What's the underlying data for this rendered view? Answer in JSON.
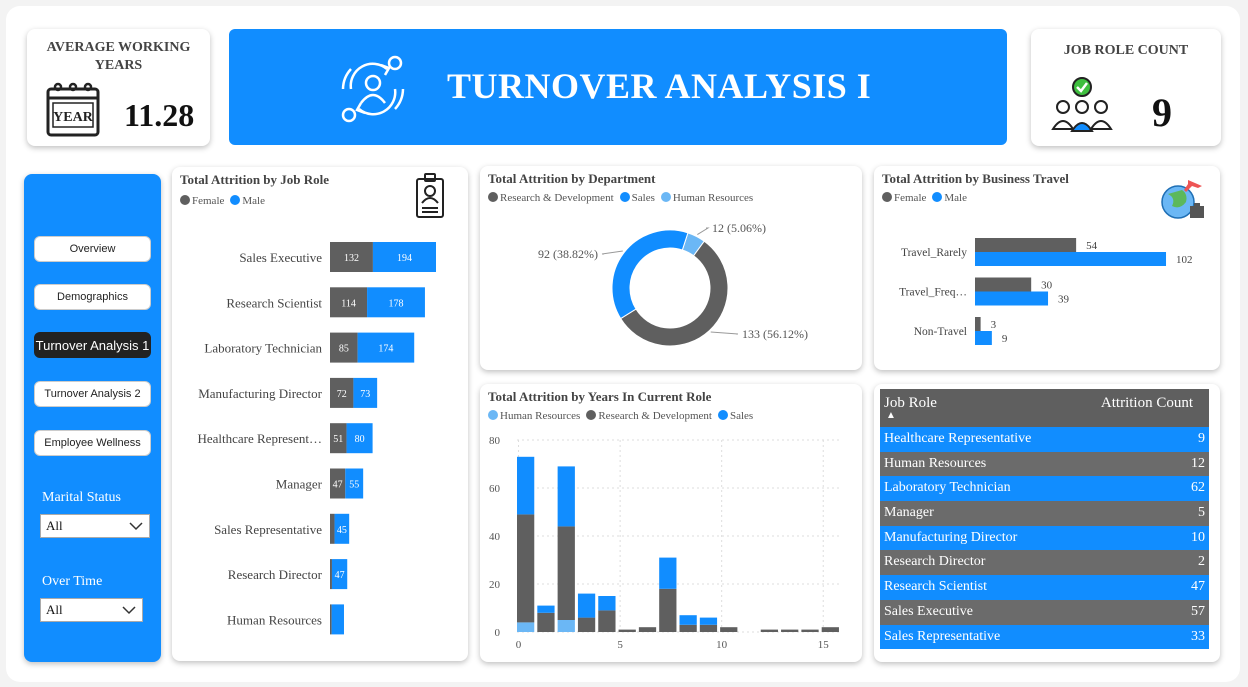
{
  "kpis": {
    "avg_working_years": {
      "title": "AVERAGE WORKING YEARS",
      "value": "11.28",
      "icon": "calendar-year-icon",
      "icon_text": "YEAR"
    },
    "job_role_count": {
      "title": "JOB ROLE COUNT",
      "value": "9",
      "icon": "team-check-icon"
    }
  },
  "banner": {
    "title": "TURNOVER ANALYSIS I",
    "icon": "employee-turnover-icon"
  },
  "nav": {
    "buttons": [
      {
        "label": "Overview",
        "active": false
      },
      {
        "label": "Demographics",
        "active": false
      },
      {
        "label": "Turnover Analysis 1",
        "active": true
      },
      {
        "label": "Turnover Analysis 2",
        "active": false
      },
      {
        "label": "Employee Wellness",
        "active": false
      }
    ],
    "slicers": [
      {
        "label": "Marital Status",
        "value": "All"
      },
      {
        "label": "Over Time",
        "value": "All"
      }
    ]
  },
  "colors": {
    "female": "#5f5f5f",
    "male": "#118DFF",
    "hr": "#6BB7F5",
    "rd": "#5f5f5f",
    "sales": "#118DFF"
  },
  "chart_data": [
    {
      "id": "job_role",
      "type": "bar",
      "orientation": "horizontal",
      "stacked": true,
      "title": "Total Attrition by Job Role",
      "icon": "id-badge-icon",
      "categories": [
        "Sales Executive",
        "Research Scientist",
        "Laboratory Technician",
        "Manufacturing Director",
        "Healthcare Represent…",
        "Manager",
        "Sales Representative",
        "Research Director",
        "Human Resources"
      ],
      "series": [
        {
          "name": "Female",
          "values": [
            132,
            114,
            85,
            72,
            51,
            47,
            14,
            6,
            5
          ],
          "labels": [
            "132",
            "114",
            "85",
            "72",
            "51",
            "47",
            "",
            "",
            ""
          ]
        },
        {
          "name": "Male",
          "values": [
            194,
            178,
            174,
            73,
            80,
            55,
            45,
            47,
            38
          ],
          "labels": [
            "194",
            "178",
            "174",
            "73",
            "80",
            "55",
            "45",
            "47",
            ""
          ]
        }
      ],
      "xlim": [
        0,
        326
      ]
    },
    {
      "id": "department",
      "type": "pie",
      "donut": true,
      "title": "Total Attrition by Department",
      "categories": [
        "Research & Development",
        "Sales",
        "Human Resources"
      ],
      "values": [
        133,
        92,
        12
      ],
      "labels": [
        "133 (56.12%)",
        "92 (38.82%)",
        "12 (5.06%)"
      ]
    },
    {
      "id": "business_travel",
      "type": "bar",
      "orientation": "horizontal",
      "title": "Total Attrition by Business Travel",
      "icon": "travel-globe-icon",
      "categories": [
        "Travel_Rarely",
        "Travel_Freq…",
        "Non-Travel"
      ],
      "series": [
        {
          "name": "Female",
          "values": [
            54,
            30,
            3
          ]
        },
        {
          "name": "Male",
          "values": [
            102,
            39,
            9
          ]
        }
      ],
      "xlim": [
        0,
        110
      ]
    },
    {
      "id": "years_in_role",
      "type": "bar",
      "stacked": true,
      "title": "Total Attrition by Years In Current Role",
      "x": [
        0,
        1,
        2,
        3,
        4,
        5,
        6,
        7,
        8,
        9,
        10,
        11,
        12,
        13,
        14,
        15
      ],
      "series": [
        {
          "name": "Human Resources",
          "values": [
            4,
            0,
            5,
            0,
            0,
            0,
            0,
            0,
            0,
            0,
            0,
            0,
            0,
            0,
            0,
            0
          ]
        },
        {
          "name": "Research & Development",
          "values": [
            45,
            8,
            39,
            6,
            9,
            1,
            2,
            18,
            3,
            3,
            2,
            0,
            1,
            1,
            1,
            2
          ]
        },
        {
          "name": "Sales",
          "values": [
            24,
            3,
            25,
            10,
            6,
            0,
            0,
            13,
            4,
            3,
            0,
            0,
            0,
            0,
            0,
            0
          ]
        }
      ],
      "ylim": [
        0,
        80
      ],
      "yticks": [
        0,
        20,
        40,
        60,
        80
      ],
      "xticks": [
        0,
        5,
        10,
        15
      ],
      "grid": true
    }
  ],
  "table": {
    "headers": [
      "Job Role",
      "Attrition Count"
    ],
    "sort_indicator": "▲",
    "rows": [
      [
        "Healthcare Representative",
        "9"
      ],
      [
        "Human Resources",
        "12"
      ],
      [
        "Laboratory Technician",
        "62"
      ],
      [
        "Manager",
        "5"
      ],
      [
        "Manufacturing Director",
        "10"
      ],
      [
        "Research Director",
        "2"
      ],
      [
        "Research Scientist",
        "47"
      ],
      [
        "Sales Executive",
        "57"
      ],
      [
        "Sales Representative",
        "33"
      ]
    ]
  }
}
